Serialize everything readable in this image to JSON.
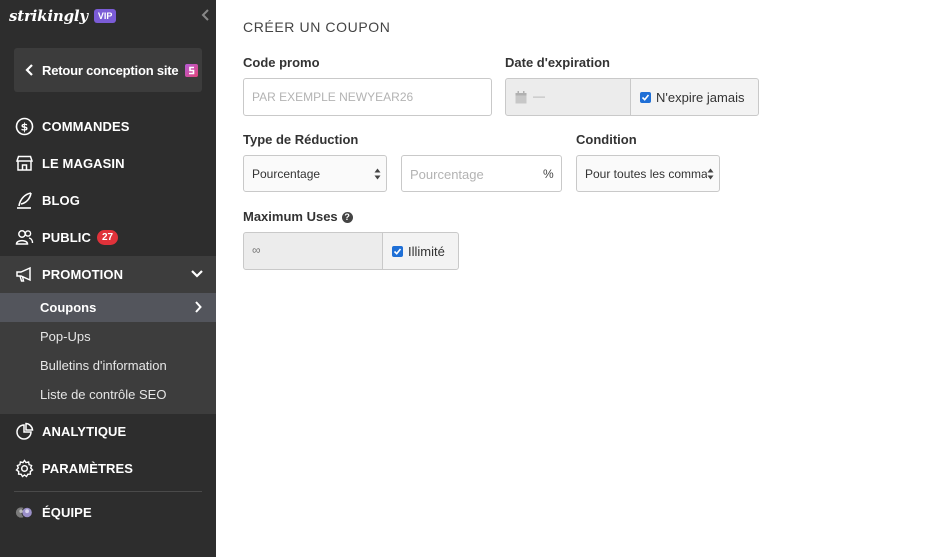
{
  "sidebar": {
    "brand": "strikingly",
    "vip": "VIP",
    "back_button": "Retour conception site",
    "items": [
      {
        "label": "COMMANDES",
        "icon": "dollar-circle-icon"
      },
      {
        "label": "LE MAGASIN",
        "icon": "store-icon"
      },
      {
        "label": "BLOG",
        "icon": "quill-icon"
      },
      {
        "label": "PUBLIC",
        "icon": "users-icon",
        "badge": "27"
      },
      {
        "label": "PROMOTION",
        "icon": "megaphone-icon"
      },
      {
        "label": "ANALYTIQUE",
        "icon": "pie-chart-icon"
      },
      {
        "label": "PARAMÈTRES",
        "icon": "gear-icon"
      },
      {
        "label": "ÉQUIPE",
        "icon": "team-avatars-icon"
      }
    ],
    "subitems": [
      {
        "label": "Coupons"
      },
      {
        "label": "Pop-Ups"
      },
      {
        "label": "Bulletins d'information"
      },
      {
        "label": "Liste de contrôle SEO"
      }
    ]
  },
  "form": {
    "title": "CRÉER UN COUPON",
    "code_label": "Code promo",
    "code_placeholder": "PAR EXEMPLE NEWYEAR26",
    "expiry_label": "Date d'expiration",
    "expiry_placeholder": "—",
    "never_expires": "N'expire jamais",
    "reduction_label": "Type de Réduction",
    "reduction_value": "Pourcentage",
    "percent_placeholder": "Pourcentage",
    "percent_unit": "%",
    "condition_label": "Condition",
    "condition_value": "Pour toutes les commandes",
    "max_uses_label": "Maximum Uses",
    "max_uses_value": "∞",
    "unlimited": "Illimité"
  },
  "colors": {
    "sidebar_bg": "#2d2d2d",
    "active_bg": "#3d3d3d",
    "sub_active_bg": "#53555c",
    "vip": "#7b5cd6",
    "badge_red": "#e0323a",
    "checkbox_blue": "#1f6fd6"
  }
}
